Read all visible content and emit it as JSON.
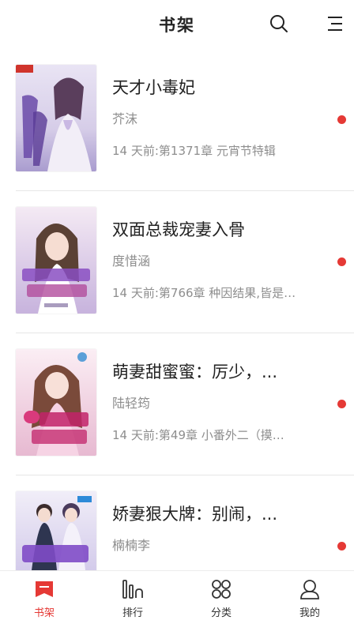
{
  "header": {
    "title": "书架",
    "search_icon": "search-icon",
    "menu_icon": "menu-icon"
  },
  "colors": {
    "accent": "#e53935",
    "text_primary": "#222222",
    "text_secondary": "#8e8e8e",
    "divider": "#e6e6e6"
  },
  "books": [
    {
      "title": "天才小毒妃",
      "author": "芥沫",
      "update": "14 天前:第1371章 元宵节特辑",
      "unread": true,
      "cover_icon": "book-cover-image"
    },
    {
      "title": "双面总裁宠妻入骨",
      "author": "度惜涵",
      "update": "14 天前:第766章 种因结果,皆是…",
      "unread": true,
      "cover_icon": "book-cover-image"
    },
    {
      "title": "萌妻甜蜜蜜：厉少，...",
      "author": "陆轻筠",
      "update": "14 天前:第49章 小番外二（摸…",
      "unread": true,
      "cover_icon": "book-cover-image"
    },
    {
      "title": "娇妻狠大牌：别闹，...",
      "author": "楠楠李",
      "update": "",
      "unread": true,
      "cover_icon": "book-cover-image"
    }
  ],
  "tabs": [
    {
      "label": "书架",
      "icon": "bookshelf-icon",
      "active": true
    },
    {
      "label": "排行",
      "icon": "ranking-icon",
      "active": false
    },
    {
      "label": "分类",
      "icon": "category-icon",
      "active": false
    },
    {
      "label": "我的",
      "icon": "profile-icon",
      "active": false
    }
  ]
}
